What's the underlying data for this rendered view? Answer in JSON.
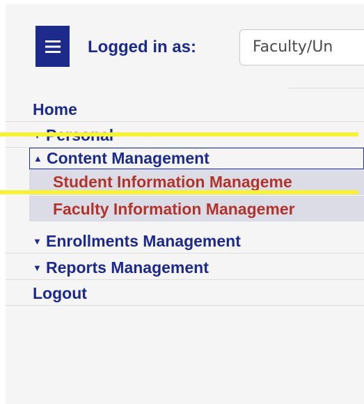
{
  "header": {
    "menu_icon": "hamburger-menu-icon",
    "logged_in_label": "Logged in as:",
    "role_select_value": "Faculty/Un"
  },
  "nav": {
    "home": "Home",
    "personal": "Personal",
    "personal_caret": "▼",
    "content_management": "Content Management",
    "content_management_caret": "▲",
    "student_information_management": "Student Information Manageme",
    "faculty_information_management": "Faculty Information Managemer",
    "enrollments_management": "Enrollments Management",
    "enrollments_management_caret": "▼",
    "reports_management": "Reports Management",
    "reports_management_caret": "▼",
    "logout": "Logout"
  },
  "colors": {
    "brand_navy": "#1c2a8b",
    "submenu_red": "#b1342c",
    "highlight_yellow": "#f6f23a",
    "submenu_band": "#dcdce6",
    "page_background": "#f5f5f6"
  }
}
